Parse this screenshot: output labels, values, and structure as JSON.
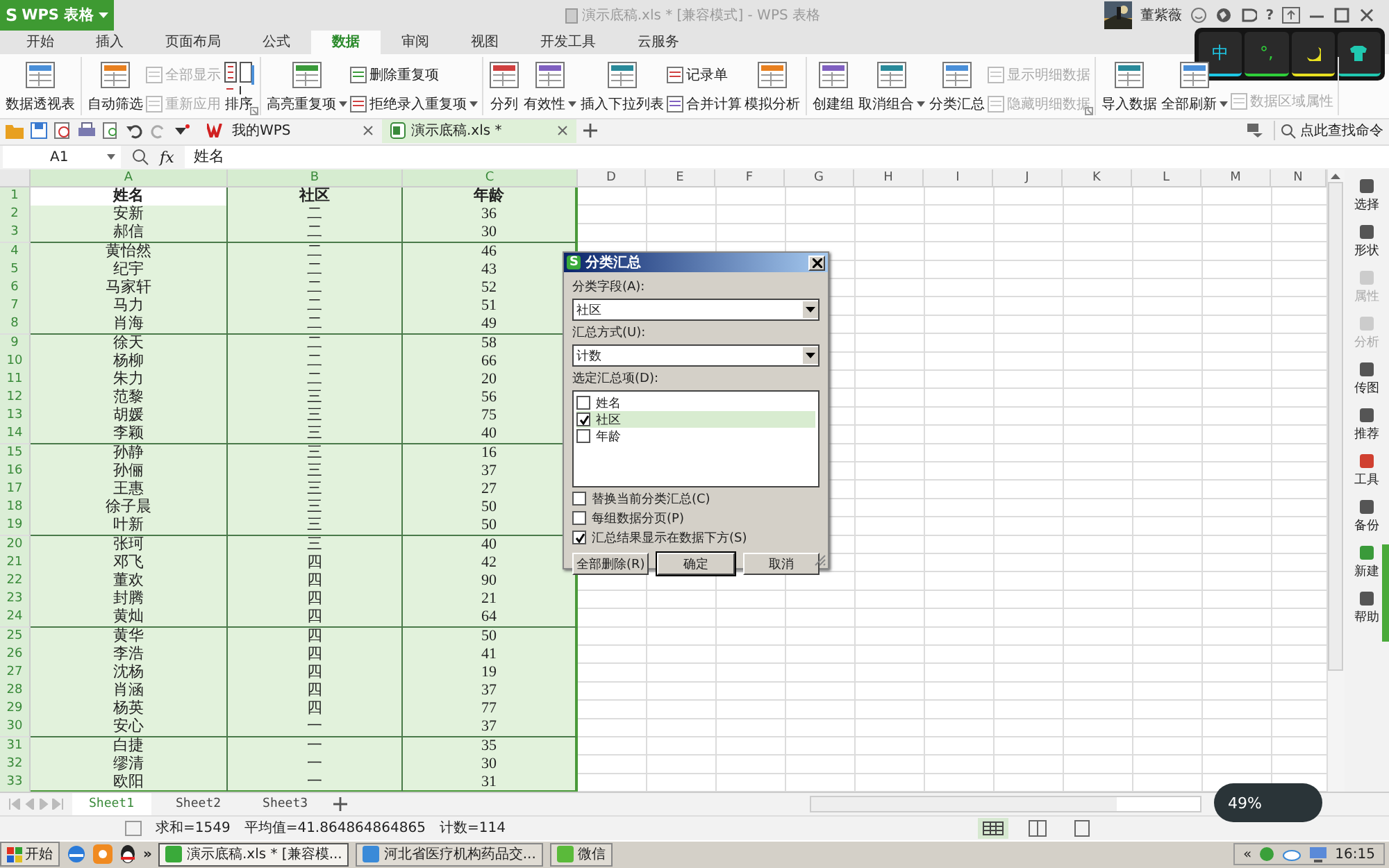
{
  "title_bar": {
    "logo": "S",
    "app_button": "WPS 表格",
    "title": "演示底稿.xls * [兼容模式] - WPS 表格",
    "user": "董紫薇",
    "help": "?"
  },
  "ime": [
    {
      "kind": "text",
      "label": "中",
      "color": "#1ec8e6"
    },
    {
      "kind": "text",
      "label": "°,",
      "color": "#2fcf3a"
    },
    {
      "kind": "moon",
      "color": "#e8e020"
    },
    {
      "kind": "shirt",
      "color": "#20c8b0"
    }
  ],
  "tabs": [
    {
      "label": "开始",
      "selected": false
    },
    {
      "label": "插入",
      "selected": false
    },
    {
      "label": "页面布局",
      "selected": false
    },
    {
      "label": "公式",
      "selected": false
    },
    {
      "label": "数据",
      "selected": true
    },
    {
      "label": "审阅",
      "selected": false
    },
    {
      "label": "视图",
      "selected": false
    },
    {
      "label": "开发工具",
      "selected": false
    },
    {
      "label": "云服务",
      "selected": false
    }
  ],
  "ribbon": [
    {
      "columns": [
        {
          "kind": "big",
          "label": "数据透视表",
          "disabled": false
        }
      ]
    },
    {
      "launcher": true,
      "columns": [
        {
          "kind": "big",
          "label": "自动筛选",
          "disabled": false
        },
        {
          "kind": "stack",
          "items": [
            {
              "label": "全部显示",
              "disabled": true
            },
            {
              "label": "重新应用",
              "disabled": true
            }
          ]
        },
        {
          "kind": "sort",
          "label": "排序",
          "disabled": false
        }
      ]
    },
    {
      "columns": [
        {
          "kind": "big",
          "label": "高亮重复项",
          "dropdown": true,
          "disabled": false
        },
        {
          "kind": "stack",
          "items": [
            {
              "label": "删除重复项",
              "disabled": false
            },
            {
              "label": "拒绝录入重复项",
              "dropdown": true,
              "disabled": false
            }
          ]
        }
      ]
    },
    {
      "columns": [
        {
          "kind": "big",
          "label": "分列",
          "disabled": false
        },
        {
          "kind": "big",
          "label": "有效性",
          "dropdown": true,
          "disabled": false
        },
        {
          "kind": "big",
          "label": "插入下拉列表",
          "disabled": false
        },
        {
          "kind": "stack",
          "items": [
            {
              "label": "记录单",
              "disabled": false
            },
            {
              "label": "合并计算",
              "disabled": false
            }
          ]
        },
        {
          "kind": "big",
          "label": "模拟分析",
          "disabled": false
        }
      ]
    },
    {
      "launcher": true,
      "columns": [
        {
          "kind": "big",
          "label": "创建组",
          "disabled": false
        },
        {
          "kind": "big",
          "label": "取消组合",
          "dropdown": true,
          "disabled": false
        },
        {
          "kind": "big",
          "label": "分类汇总",
          "disabled": false
        },
        {
          "kind": "stack",
          "items": [
            {
              "label": "显示明细数据",
              "disabled": true
            },
            {
              "label": "隐藏明细数据",
              "disabled": true
            }
          ]
        }
      ]
    },
    {
      "columns": [
        {
          "kind": "big",
          "label": "导入数据",
          "disabled": false
        },
        {
          "kind": "big",
          "label": "全部刷新",
          "dropdown": true,
          "disabled": false
        },
        {
          "kind": "stack",
          "items": [
            {
              "label": "数据区域属性",
              "disabled": true
            }
          ]
        }
      ]
    }
  ],
  "doc_tabs": [
    {
      "label": "我的WPS",
      "selected": false
    },
    {
      "label": "演示底稿.xls *",
      "selected": true
    }
  ],
  "command_search": "点此查找命令",
  "formula_bar": {
    "name_box": "A1",
    "fx": "fx",
    "value": "姓名"
  },
  "columns": [
    {
      "label": "A",
      "selected": true
    },
    {
      "label": "B",
      "selected": true
    },
    {
      "label": "C",
      "selected": true
    },
    {
      "label": "D",
      "selected": false
    },
    {
      "label": "E",
      "selected": false
    },
    {
      "label": "F",
      "selected": false
    },
    {
      "label": "G",
      "selected": false
    },
    {
      "label": "H",
      "selected": false
    },
    {
      "label": "I",
      "selected": false
    },
    {
      "label": "J",
      "selected": false
    },
    {
      "label": "K",
      "selected": false
    },
    {
      "label": "L",
      "selected": false
    },
    {
      "label": "M",
      "selected": false
    },
    {
      "label": "N",
      "selected": false
    }
  ],
  "rows": [
    {
      "num": "1",
      "selected": true,
      "active": true,
      "cells": [
        "姓名",
        "社区",
        "年龄"
      ]
    },
    {
      "num": "2",
      "selected": true,
      "active": false,
      "cells": [
        "安新",
        "二",
        "36"
      ]
    },
    {
      "num": "3",
      "selected": true,
      "active": false,
      "cells": [
        "郝信",
        "二",
        "30"
      ]
    },
    {
      "num": "4",
      "selected": true,
      "active": false,
      "cells": [
        "黄怡然",
        "二",
        "46"
      ]
    },
    {
      "num": "5",
      "selected": true,
      "active": false,
      "cells": [
        "纪宇",
        "二",
        "43"
      ]
    },
    {
      "num": "6",
      "selected": true,
      "active": false,
      "cells": [
        "马家轩",
        "二",
        "52"
      ]
    },
    {
      "num": "7",
      "selected": true,
      "active": false,
      "cells": [
        "马力",
        "二",
        "51"
      ]
    },
    {
      "num": "8",
      "selected": true,
      "active": false,
      "cells": [
        "肖海",
        "二",
        "49"
      ]
    },
    {
      "num": "9",
      "selected": true,
      "active": false,
      "cells": [
        "徐天",
        "二",
        "58"
      ]
    },
    {
      "num": "10",
      "selected": true,
      "active": false,
      "cells": [
        "杨柳",
        "二",
        "66"
      ]
    },
    {
      "num": "11",
      "selected": true,
      "active": false,
      "cells": [
        "朱力",
        "二",
        "20"
      ]
    },
    {
      "num": "12",
      "selected": true,
      "active": false,
      "cells": [
        "范黎",
        "三",
        "56"
      ]
    },
    {
      "num": "13",
      "selected": true,
      "active": false,
      "cells": [
        "胡媛",
        "三",
        "75"
      ]
    },
    {
      "num": "14",
      "selected": true,
      "active": false,
      "cells": [
        "李颖",
        "三",
        "40"
      ]
    },
    {
      "num": "15",
      "selected": true,
      "active": false,
      "cells": [
        "孙静",
        "三",
        "16"
      ]
    },
    {
      "num": "16",
      "selected": true,
      "active": false,
      "cells": [
        "孙俪",
        "三",
        "37"
      ]
    },
    {
      "num": "17",
      "selected": true,
      "active": false,
      "cells": [
        "王惠",
        "三",
        "27"
      ]
    },
    {
      "num": "18",
      "selected": true,
      "active": false,
      "cells": [
        "徐子晨",
        "三",
        "50"
      ]
    },
    {
      "num": "19",
      "selected": true,
      "active": false,
      "cells": [
        "叶新",
        "三",
        "50"
      ]
    },
    {
      "num": "20",
      "selected": true,
      "active": false,
      "cells": [
        "张珂",
        "三",
        "40"
      ]
    },
    {
      "num": "21",
      "selected": true,
      "active": false,
      "cells": [
        "邓飞",
        "四",
        "42"
      ]
    },
    {
      "num": "22",
      "selected": true,
      "active": false,
      "cells": [
        "董欢",
        "四",
        "90"
      ]
    },
    {
      "num": "23",
      "selected": true,
      "active": false,
      "cells": [
        "封腾",
        "四",
        "21"
      ]
    },
    {
      "num": "24",
      "selected": true,
      "active": false,
      "cells": [
        "黄灿",
        "四",
        "64"
      ]
    },
    {
      "num": "25",
      "selected": true,
      "active": false,
      "cells": [
        "黄华",
        "四",
        "50"
      ]
    },
    {
      "num": "26",
      "selected": true,
      "active": false,
      "cells": [
        "李浩",
        "四",
        "41"
      ]
    },
    {
      "num": "27",
      "selected": true,
      "active": false,
      "cells": [
        "沈杨",
        "四",
        "19"
      ]
    },
    {
      "num": "28",
      "selected": true,
      "active": false,
      "cells": [
        "肖涵",
        "四",
        "37"
      ]
    },
    {
      "num": "29",
      "selected": true,
      "active": false,
      "cells": [
        "杨英",
        "四",
        "77"
      ]
    },
    {
      "num": "30",
      "selected": true,
      "active": false,
      "cells": [
        "安心",
        "一",
        "37"
      ]
    },
    {
      "num": "31",
      "selected": true,
      "active": false,
      "cells": [
        "白捷",
        "一",
        "35"
      ]
    },
    {
      "num": "32",
      "selected": true,
      "active": false,
      "cells": [
        "缪清",
        "一",
        "30"
      ]
    },
    {
      "num": "33",
      "selected": true,
      "active": false,
      "cells": [
        "欧阳",
        "一",
        "31"
      ]
    }
  ],
  "side_panel": [
    {
      "label": "选择",
      "disabled": false
    },
    {
      "label": "形状",
      "disabled": false
    },
    {
      "label": "属性",
      "disabled": true
    },
    {
      "label": "分析",
      "disabled": true
    },
    {
      "label": "传图",
      "disabled": false
    },
    {
      "label": "推荐",
      "disabled": false
    },
    {
      "label": "工具",
      "disabled": false
    },
    {
      "label": "备份",
      "disabled": false
    },
    {
      "label": "新建",
      "disabled": false
    },
    {
      "label": "帮助",
      "disabled": false
    }
  ],
  "dialog": {
    "logo": "S",
    "title": "分类汇总",
    "fields": [
      {
        "label": "分类字段(A):",
        "value": "社区"
      },
      {
        "label": "汇总方式(U):",
        "value": "计数"
      }
    ],
    "list_label": "选定汇总项(D):",
    "list": [
      {
        "label": "姓名",
        "checked": false,
        "selected": false
      },
      {
        "label": "社区",
        "checked": true,
        "selected": true
      },
      {
        "label": "年龄",
        "checked": false,
        "selected": false
      }
    ],
    "options": [
      {
        "label": "替换当前分类汇总(C)",
        "checked": false
      },
      {
        "label": "每组数据分页(P)",
        "checked": false
      },
      {
        "label": "汇总结果显示在数据下方(S)",
        "checked": true
      }
    ],
    "buttons": [
      {
        "label": "全部删除(R)",
        "default": false
      },
      {
        "label": "确定",
        "default": true
      },
      {
        "label": "取消",
        "default": false
      }
    ]
  },
  "sheet_tabs": [
    {
      "label": "Sheet1",
      "selected": true
    },
    {
      "label": "Sheet2",
      "selected": false
    },
    {
      "label": "Sheet3",
      "selected": false
    }
  ],
  "status_bar": [
    "求和=1549",
    "平均值=41.864864864865",
    "计数=114"
  ],
  "speed_widget": "49%",
  "taskbar": {
    "start": "开始",
    "more": "»",
    "tasks": [
      {
        "label": "演示底稿.xls * [兼容模...",
        "selected": true
      },
      {
        "label": "河北省医疗机构药品交...",
        "selected": false
      },
      {
        "label": "微信",
        "selected": false
      }
    ],
    "tray_more": "«",
    "clock": "16:15"
  }
}
